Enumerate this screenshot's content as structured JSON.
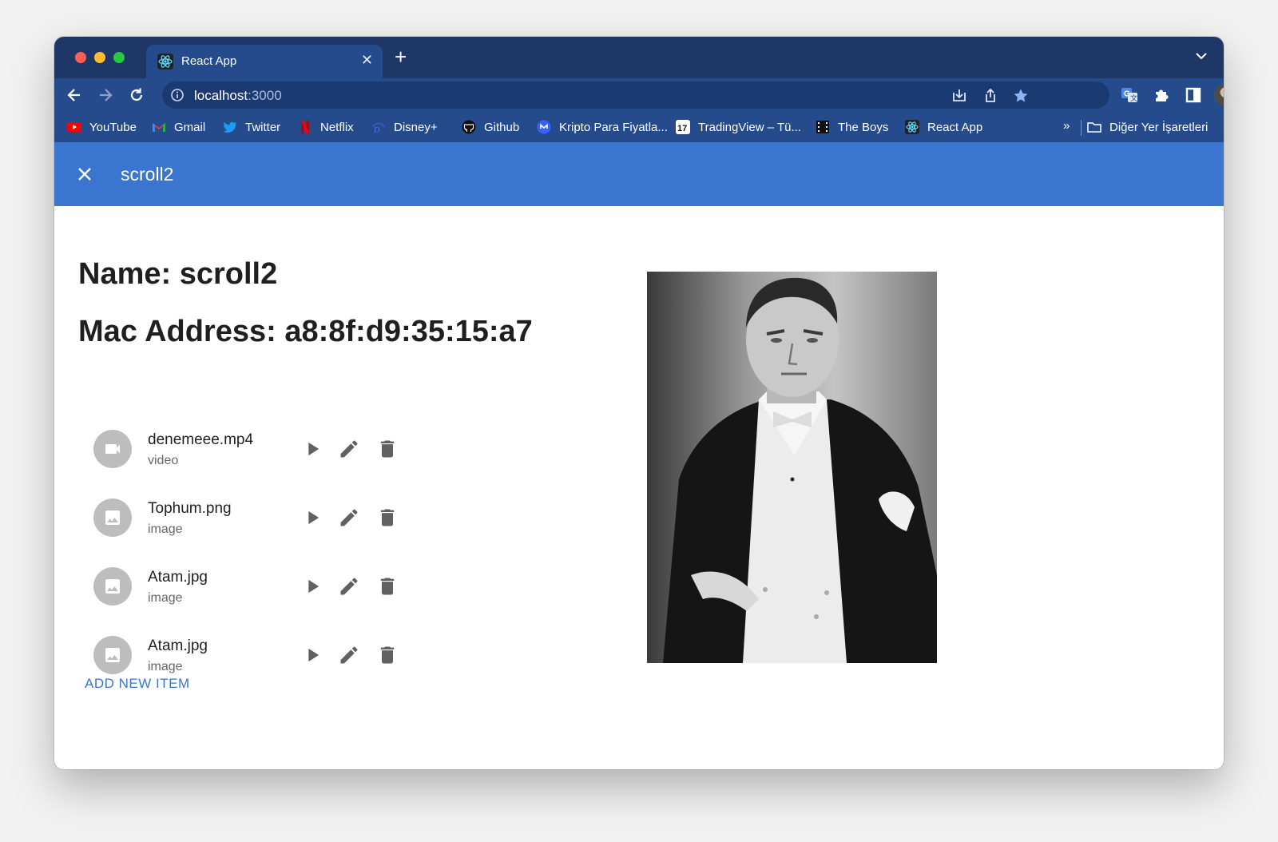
{
  "browser": {
    "tab_title": "React App",
    "url_host": "localhost",
    "url_port": ":3000",
    "bookmarks": [
      {
        "label": "YouTube",
        "icon": "youtube-icon"
      },
      {
        "label": "Gmail",
        "icon": "gmail-icon"
      },
      {
        "label": "Twitter",
        "icon": "twitter-icon"
      },
      {
        "label": "Netflix",
        "icon": "netflix-icon"
      },
      {
        "label": "Disney+",
        "icon": "disney-icon"
      },
      {
        "label": "Github",
        "icon": "github-icon"
      },
      {
        "label": "Kripto Para Fiyatla...",
        "icon": "crypto-icon"
      },
      {
        "label": "TradingView – Tü...",
        "icon": "tradingview-icon"
      },
      {
        "label": "The Boys",
        "icon": "film-icon"
      },
      {
        "label": "React App",
        "icon": "react-icon"
      }
    ],
    "bookmarks_overflow": "»",
    "other_bookmarks": "Diğer Yer İşaretleri"
  },
  "app_bar": {
    "title": "scroll2"
  },
  "device": {
    "name_line": "Name: scroll2",
    "mac_line": "Mac Address: a8:8f:d9:35:15:a7"
  },
  "items": [
    {
      "name": "denemeee.mp4",
      "type": "video"
    },
    {
      "name": "Tophum.png",
      "type": "image"
    },
    {
      "name": "Atam.jpg",
      "type": "image"
    },
    {
      "name": "Atam.jpg",
      "type": "image"
    }
  ],
  "add_button": "ADD NEW ITEM",
  "colors": {
    "tabstrip": "#1e3766",
    "toolbar": "#264b8d",
    "app_bar": "#3a76d0",
    "accent": "#3a76d0",
    "avatar_grey": "#bdbdbd",
    "action_icon": "#616161"
  }
}
